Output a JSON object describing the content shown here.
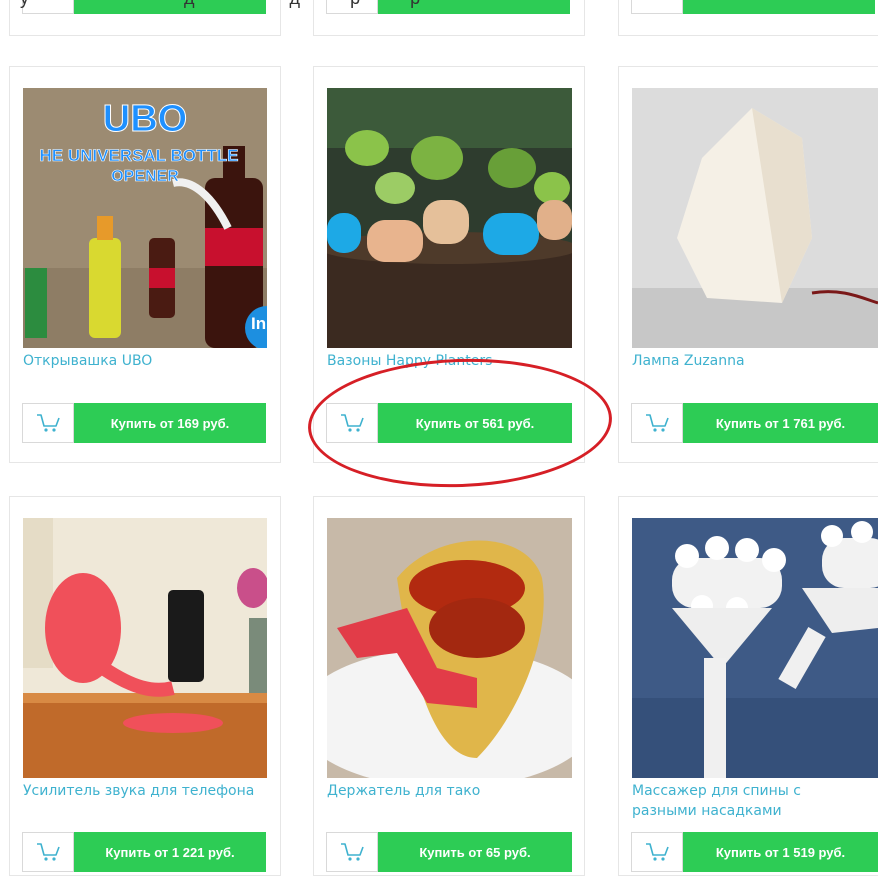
{
  "colors": {
    "accent_green": "#2dcc55",
    "title_blue": "#3fb2cf",
    "highlight_red": "#d61f26"
  },
  "top_row_partial": {
    "top_text": "у                               д                   д          р          р"
  },
  "products": [
    {
      "title": "Открывашка UBO",
      "buy_label": "Купить от 169 руб.",
      "thumb_text_1": "UBO",
      "thumb_text_2": "HE UNIVERSAL BOTTLE",
      "thumb_text_3": "OPENER",
      "badge": "In"
    },
    {
      "title": "Вазоны Happy Planters",
      "buy_label": "Купить от 561 руб."
    },
    {
      "title": "Лампа Zuzanna",
      "buy_label": "Купить от 1 761 руб."
    },
    {
      "title": "Усилитель звука для телефона",
      "buy_label": "Купить от 1 221 руб."
    },
    {
      "title": "Держатель для тако",
      "buy_label": "Купить от 65 руб."
    },
    {
      "title_line1": "Массажер для спины с",
      "title_line2": "разными насадками",
      "buy_label": "Купить от 1 519 руб."
    }
  ]
}
